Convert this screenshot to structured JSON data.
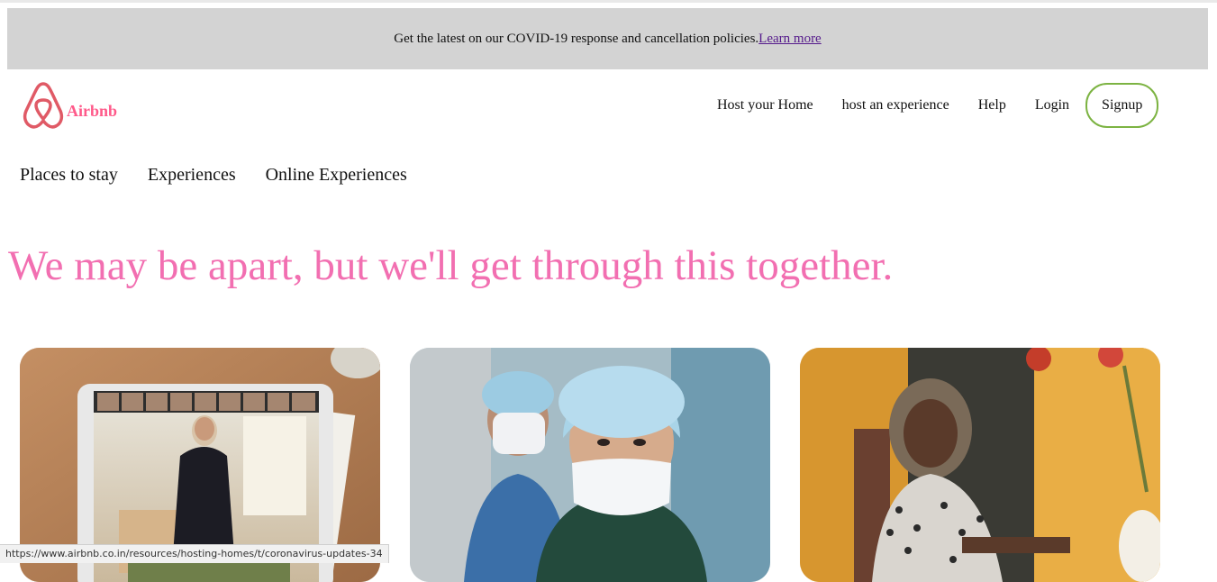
{
  "banner": {
    "text": "Get the latest on our COVID-19 response and cancellation policies.",
    "link": "Learn more"
  },
  "logo": {
    "icon": "airbnb-logo-icon",
    "text": "Airbnb",
    "color": "#e05a66"
  },
  "topnav": {
    "host_home": "Host your Home",
    "host_experience": "host an experience",
    "help": "Help",
    "login": "Login",
    "signup": "Signup"
  },
  "subnav": {
    "places": "Places to stay",
    "experiences": "Experiences",
    "online": "Online Experiences"
  },
  "hero": {
    "title": "We may be apart, but we'll get through this together."
  },
  "cards": [
    {
      "name": "video-call-tablet-image"
    },
    {
      "name": "medical-workers-image"
    },
    {
      "name": "host-woman-image"
    }
  ],
  "status_bar": {
    "url": "https://www.airbnb.co.in/resources/hosting-homes/t/coronavirus-updates-34"
  },
  "colors": {
    "accent_pink": "#f26fb1",
    "signup_border": "#7cb342",
    "banner_bg": "#d3d3d3"
  }
}
